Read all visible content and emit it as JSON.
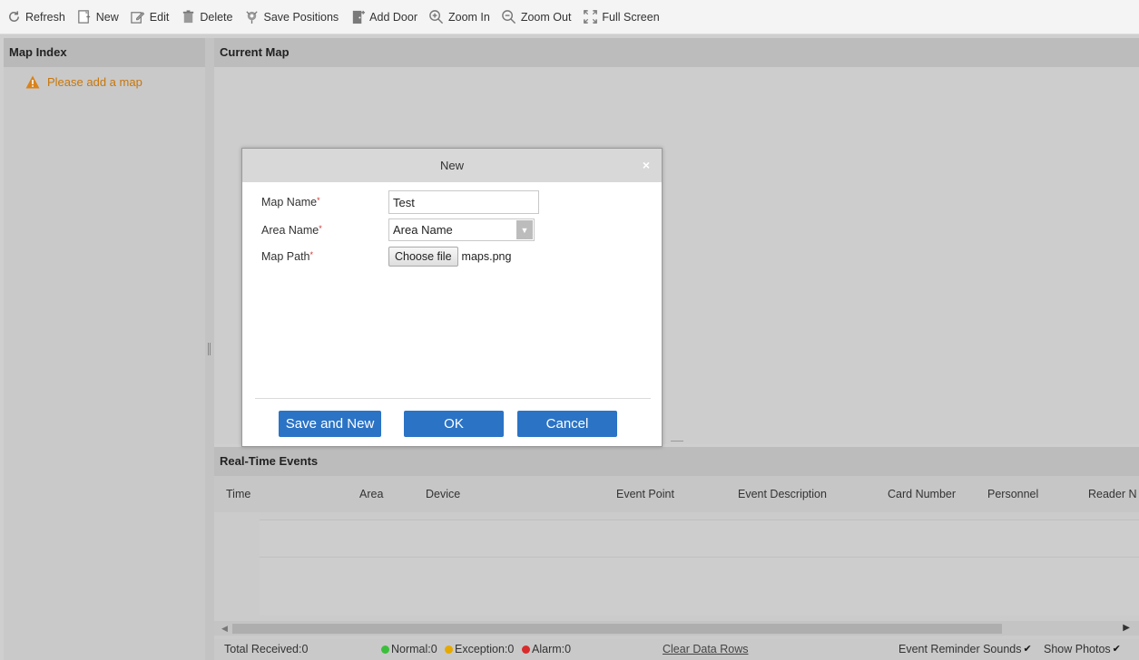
{
  "toolbar": {
    "items": [
      {
        "label": "Refresh",
        "icon": "refresh-icon"
      },
      {
        "label": "New",
        "icon": "new-file-icon"
      },
      {
        "label": "Edit",
        "icon": "edit-icon"
      },
      {
        "label": "Delete",
        "icon": "delete-icon"
      },
      {
        "label": "Save Positions",
        "icon": "save-positions-icon"
      },
      {
        "label": "Add Door",
        "icon": "add-door-icon"
      },
      {
        "label": "Zoom In",
        "icon": "zoom-in-icon"
      },
      {
        "label": "Zoom Out",
        "icon": "zoom-out-icon"
      },
      {
        "label": "Full Screen",
        "icon": "full-screen-icon"
      }
    ]
  },
  "map_index": {
    "title": "Map Index",
    "hint": "Please add a map"
  },
  "current_map": {
    "title": "Current Map"
  },
  "dialog": {
    "title": "New",
    "close": "×",
    "required_mark": "*",
    "map_name_label": "Map Name",
    "map_name_value": "Test",
    "area_name_label": "Area Name",
    "area_name_value": "Area Name",
    "map_path_label": "Map Path",
    "choose_file_label": "Choose file",
    "file_name": "maps.png",
    "save_and_new_label": "Save and New",
    "ok_label": "OK",
    "cancel_label": "Cancel"
  },
  "events": {
    "title": "Real-Time Events",
    "columns": [
      "Time",
      "Area",
      "Device",
      "Event Point",
      "Event Description",
      "Card Number",
      "Personnel",
      "Reader N"
    ],
    "status": {
      "total_received": "Total Received:0",
      "normal": "Normal:0",
      "exception": "Exception:0",
      "alarm": "Alarm:0",
      "clear": "Clear Data Rows",
      "reminder": "Event Reminder Sounds",
      "show_photos": "Show Photos"
    }
  },
  "colors": {
    "accent_button": "#2b73c5",
    "warning": "#c8760a",
    "normal_dot": "#3bbf3b",
    "exception_dot": "#e5a900",
    "alarm_dot": "#d92b2b"
  }
}
